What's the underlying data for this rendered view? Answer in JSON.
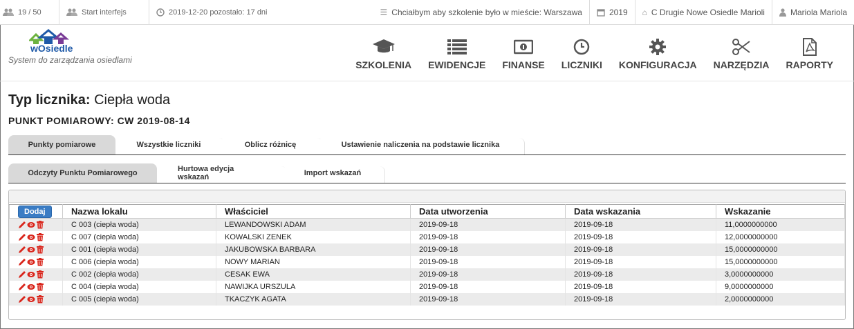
{
  "topbar": {
    "counter": "19 / 50",
    "start": "Start interfejs",
    "date_remaining": "2019-12-20 pozostało: 17 dni",
    "training_wish": "Chciałbym aby szkolenie było w mieście: Warszawa",
    "year": "2019",
    "estate": "C Drugie Nowe Osiedle Marioli",
    "user": "Mariola Mariola"
  },
  "brand": {
    "name": "wOsiedle",
    "tagline": "System do zarządzania osiedlami"
  },
  "nav": [
    {
      "label": "SZKOLENIA",
      "icon": "graduation-cap-icon"
    },
    {
      "label": "EWIDENCJE",
      "icon": "list-icon"
    },
    {
      "label": "FINANSE",
      "icon": "money-icon"
    },
    {
      "label": "LICZNIKI",
      "icon": "clock-icon"
    },
    {
      "label": "KONFIGURACJA",
      "icon": "gear-icon"
    },
    {
      "label": "NARZĘDZIA",
      "icon": "scissors-icon"
    },
    {
      "label": "RAPORTY",
      "icon": "file-pdf-icon"
    }
  ],
  "page": {
    "title_label": "Typ licznika:",
    "title_value": "Ciepła woda",
    "subtitle": "PUNKT POMIAROWY: CW 2019-08-14"
  },
  "tabs_main": [
    {
      "label": "Punkty pomiarowe",
      "active": true
    },
    {
      "label": "Wszystkie liczniki",
      "active": false
    },
    {
      "label": "Oblicz różnicę",
      "active": false
    },
    {
      "label": "Ustawienie naliczenia na podstawie licznika",
      "active": false
    }
  ],
  "tabs_sub": [
    {
      "label": "Odczyty Punktu Pomiarowego",
      "active": true
    },
    {
      "label": "Hurtowa edycja wskazań",
      "active": false
    },
    {
      "label": "Import wskazań",
      "active": false
    }
  ],
  "table": {
    "add_label": "Dodaj",
    "columns": [
      "Nazwa lokalu",
      "Właściciel",
      "Data utworzenia",
      "Data wskazania",
      "Wskazanie"
    ],
    "rows": [
      [
        "C 003 (ciepła woda)",
        "LEWANDOWSKI ADAM",
        "2019-09-18",
        "2019-09-18",
        "11,0000000000"
      ],
      [
        "C 007 (ciepła woda)",
        "KOWALSKI ZENEK",
        "2019-09-18",
        "2019-09-18",
        "12,0000000000"
      ],
      [
        "C 001 (ciepła woda)",
        "JAKUBOWSKA BARBARA",
        "2019-09-18",
        "2019-09-18",
        "15,0000000000"
      ],
      [
        "C 006 (ciepła woda)",
        "NOWY MARIAN",
        "2019-09-18",
        "2019-09-18",
        "15,0000000000"
      ],
      [
        "C 002 (ciepła woda)",
        "CESAK EWA",
        "2019-09-18",
        "2019-09-18",
        "3,0000000000"
      ],
      [
        "C 004 (ciepła woda)",
        "NAWIJKA URSZULA",
        "2019-09-18",
        "2019-09-18",
        "9,0000000000"
      ],
      [
        "C 005 (ciepła woda)",
        "TKACZYK AGATA",
        "2019-09-18",
        "2019-09-18",
        "2,0000000000"
      ]
    ]
  },
  "colors": {
    "accent": "#3a7cc4",
    "action_red": "#d9261c",
    "row_alt": "#ebebeb",
    "tab_active": "#d9d9d9"
  }
}
